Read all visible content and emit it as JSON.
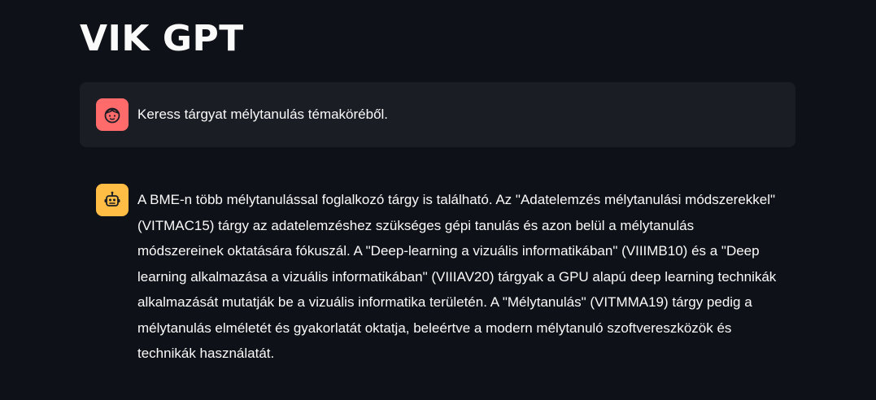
{
  "app": {
    "title": "VIK GPT"
  },
  "messages": [
    {
      "role": "user",
      "avatar_icon": "user-face-icon",
      "text": "Keress tárgyat mélytanulás témaköréből."
    },
    {
      "role": "assistant",
      "avatar_icon": "robot-icon",
      "text": "A BME-n több mélytanulással foglalkozó tárgy is található. Az \"Adatelemzés mélytanulási módszerekkel\" (VITMAC15) tárgy az adatelemzéshez szükséges gépi tanulás és azon belül a mélytanulás módszereinek oktatására fókuszál. A \"Deep-learning a vizuális informatikában\" (VIIIMB10) és a \"Deep learning alkalmazása a vizuális informatikában\" (VIIIAV20) tárgyak a GPU alapú deep learning technikák alkalmazását mutatják be a vizuális informatika területén. A \"Mélytanulás\" (VITMMA19) tárgy pedig a mélytanulás elméletét és gyakorlatát oktatja, beleértve a modern mélytanuló szoftvereszközök és technikák használatát."
    }
  ],
  "colors": {
    "background": "#0e1117",
    "user_bubble": "#1b1d25",
    "user_avatar": "#ff6b6b",
    "bot_avatar": "#ffbd45",
    "text": "#fafafa"
  }
}
